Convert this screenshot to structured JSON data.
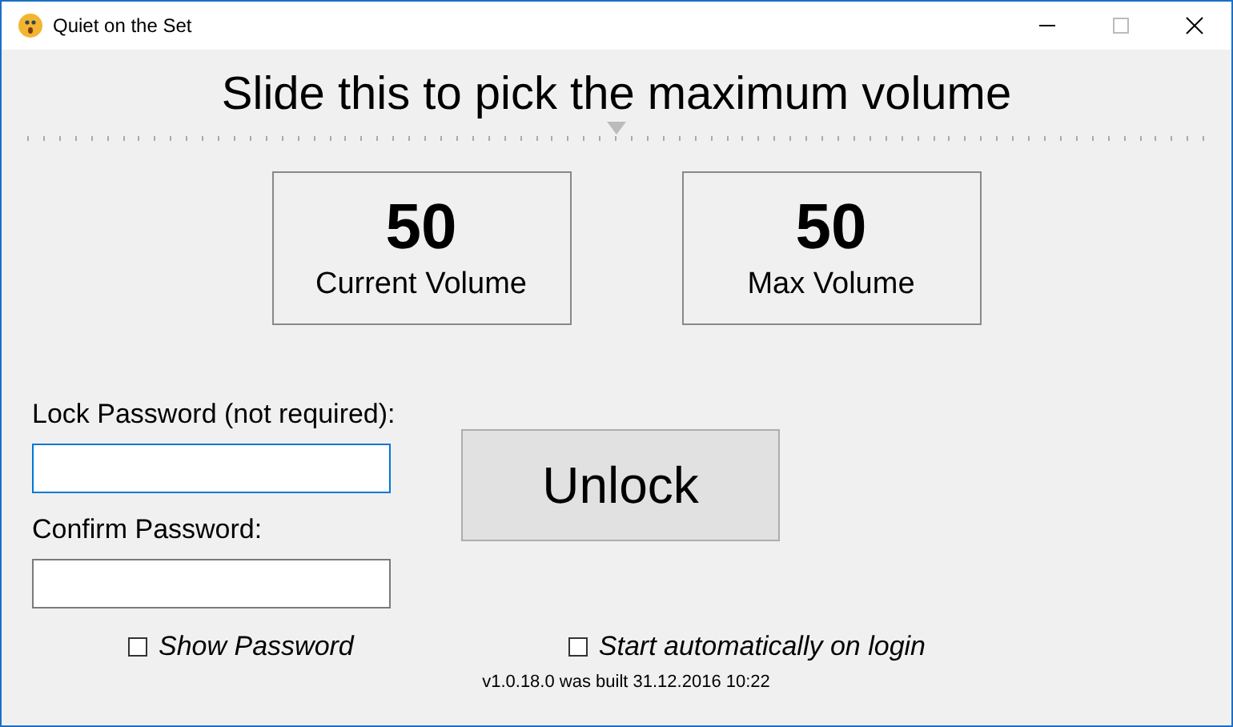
{
  "window": {
    "title": "Quiet on the Set"
  },
  "heading": "Slide this to pick the maximum volume",
  "slider": {
    "level": 0.5
  },
  "readouts": [
    {
      "value": "50",
      "label": "Current Volume"
    },
    {
      "value": "50",
      "label": "Max Volume"
    }
  ],
  "fields": [
    {
      "label": "Lock Password (not required):",
      "focused": true
    },
    {
      "label": "Confirm Password:",
      "focused": false
    }
  ],
  "unlock_button": "Unlock",
  "checkboxes": [
    {
      "label": "Show Password",
      "checked": false
    },
    {
      "label": "Start automatically on login",
      "checked": false
    }
  ],
  "footer": "v1.0.18.0 was built 31.12.2016 10:22"
}
